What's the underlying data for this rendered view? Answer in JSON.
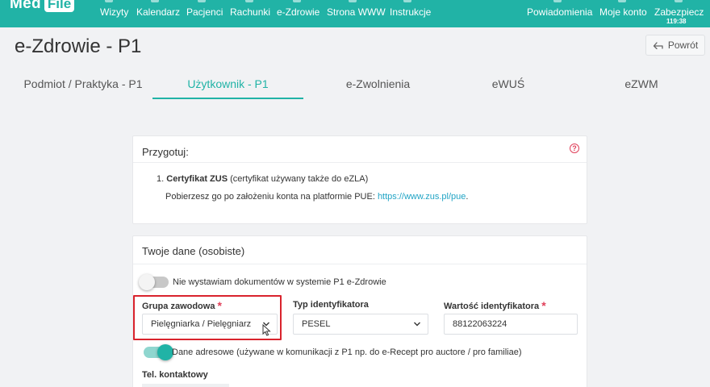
{
  "nav": {
    "logo_part1": "Med",
    "logo_part2": "File",
    "items": [
      "Wizyty",
      "Kalendarz",
      "Pacjenci",
      "Rachunki",
      "e-Zdrowie",
      "Strona WWW",
      "Instrukcje"
    ],
    "right_items": [
      "Powiadomienia",
      "Moje konto",
      "Zabezpiecz"
    ],
    "timer": "119:38"
  },
  "page": {
    "title": "e-Zdrowie - P1",
    "back_label": "Powrót"
  },
  "tabs": [
    {
      "label": "Podmiot / Praktyka - P1",
      "active": false
    },
    {
      "label": "Użytkownik - P1",
      "active": true
    },
    {
      "label": "e-Zwolnienia",
      "active": false
    },
    {
      "label": "eWUŚ",
      "active": false
    },
    {
      "label": "eZWM",
      "active": false
    }
  ],
  "prepare_card": {
    "title": "Przygotuj:",
    "item_number": "1.",
    "item_bold": "Certyfikat ZUS",
    "item_rest": " (certyfikat używany także do eZLA)",
    "sub_text": "Pobierzesz go po założeniu konta na platformie PUE: ",
    "sub_link": "https://www.zus.pl/pue",
    "sub_end": "."
  },
  "personal_card": {
    "title": "Twoje dane (osobiste)",
    "toggle1": {
      "label": "Nie wystawiam dokumentów w systemie P1 e-Zdrowie",
      "on": false
    },
    "fields": {
      "grupa_label": "Grupa zawodowa",
      "grupa_value": "Pielęgniarka / Pielęgniarz",
      "typ_label": "Typ identyfikatora",
      "typ_value": "PESEL",
      "wartosc_label": "Wartość identyfikatora",
      "wartosc_value": "88122063224",
      "required_mark": "*"
    },
    "toggle2": {
      "label": "Dane adresowe (używane w komunikacji z P1 np. do e-Recept pro auctore / pro familiae)",
      "on": true
    },
    "tel_label": "Tel. kontaktowy"
  },
  "colors": {
    "accent": "#21b3a6",
    "highlight": "#d9232d",
    "link": "#21a4c5"
  }
}
